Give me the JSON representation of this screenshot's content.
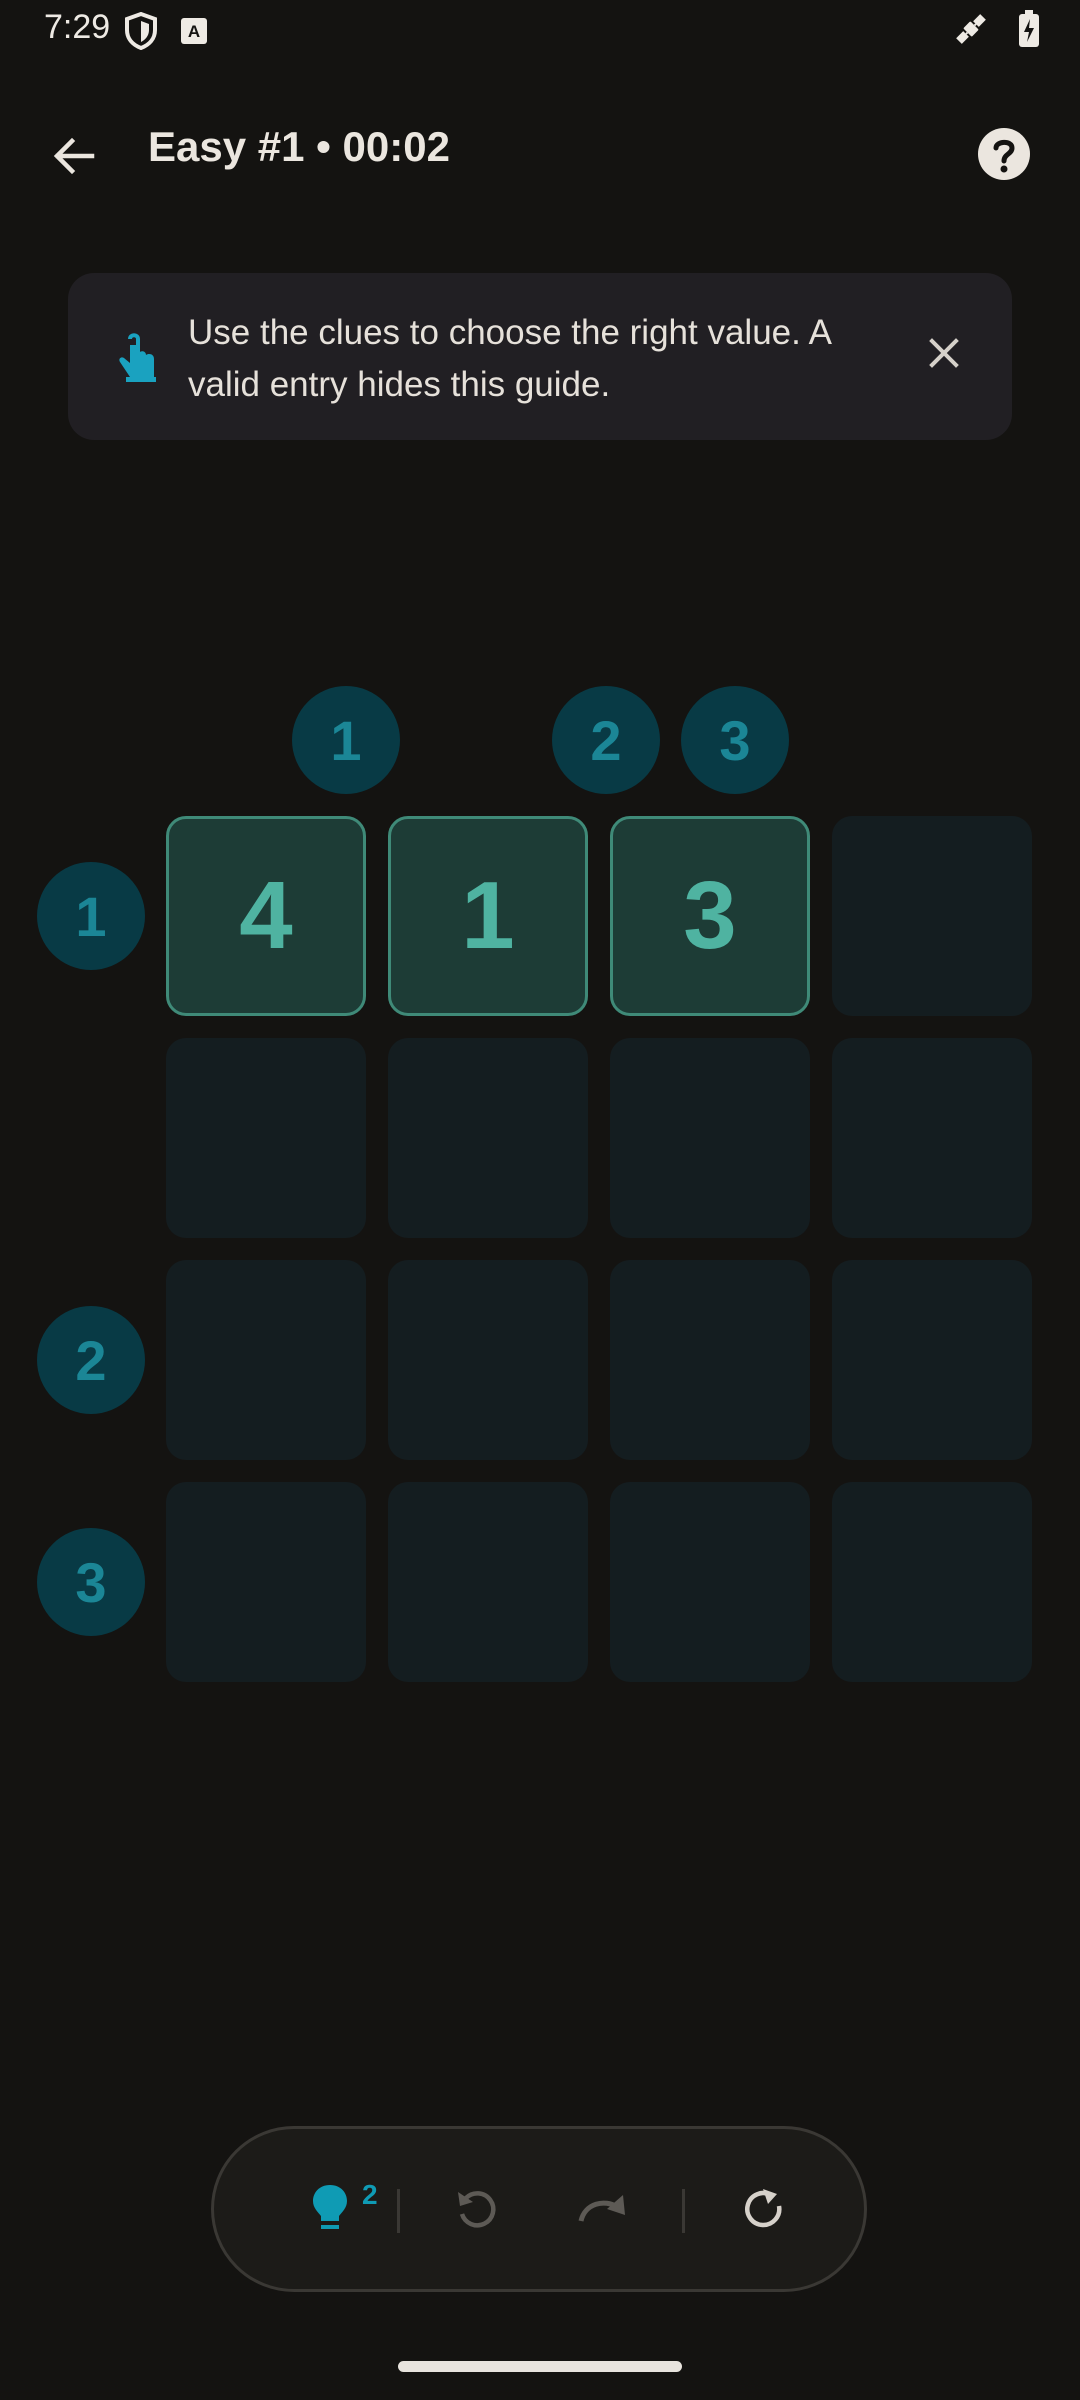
{
  "status_bar": {
    "time": "7:29",
    "left_icons": [
      "shield-icon",
      "keyboard-a-icon"
    ],
    "right_icons": [
      "satellite-icon",
      "battery-charging-icon"
    ]
  },
  "app_bar": {
    "title": "Easy #1 • 00:02",
    "back_icon": "arrow-back-icon",
    "help_icon": "help-circle-icon"
  },
  "guide": {
    "text": "Use the clues to choose the right value. A valid entry hides this guide.",
    "icon": "tap-hand-icon",
    "close_icon": "close-icon"
  },
  "clues": {
    "columns": [
      "1",
      "2",
      "3"
    ],
    "rows": [
      "1",
      "2",
      "3"
    ]
  },
  "grid": {
    "rows": 4,
    "cols": 4,
    "cells": [
      [
        "4",
        "1",
        "3",
        ""
      ],
      [
        "",
        "",
        "",
        ""
      ],
      [
        "",
        "",
        "",
        ""
      ],
      [
        "",
        "",
        "",
        ""
      ]
    ]
  },
  "toolbar": {
    "hint_count": "2",
    "hint_icon": "lightbulb-icon",
    "undo_icon": "undo-icon",
    "redo_icon": "redo-icon",
    "restart_icon": "restart-icon"
  },
  "colors": {
    "background": "#141311",
    "clue_bg": "#083a45",
    "clue_text": "#1b8696",
    "cell_empty": "#141d20",
    "cell_filled": "#1d3c36",
    "cell_text": "#4fb3a1",
    "accent": "#0f9bb4"
  }
}
